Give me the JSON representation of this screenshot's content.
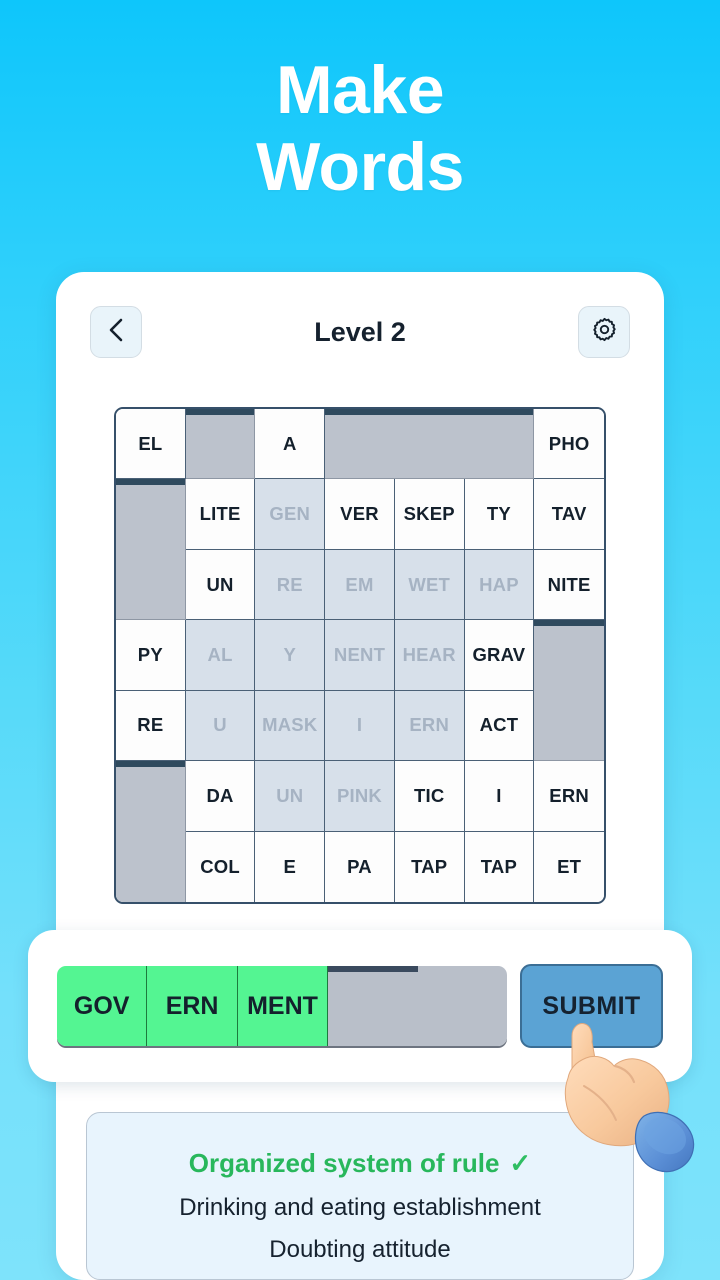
{
  "headline": {
    "line1": "Make",
    "line2": "Words"
  },
  "appbar": {
    "title": "Level 2",
    "back_icon": "chevron-left-icon",
    "settings_icon": "gear-icon"
  },
  "grid": {
    "rows": 7,
    "cols": 7,
    "cells": [
      [
        {
          "text": "EL",
          "state": "available"
        },
        {
          "text": "",
          "state": "blocked"
        },
        {
          "text": "A",
          "state": "available"
        },
        {
          "text": "",
          "state": "blocked"
        },
        {
          "text": "",
          "state": "blocked"
        },
        {
          "text": "",
          "state": "blocked"
        },
        {
          "text": "PHO",
          "state": "available"
        }
      ],
      [
        {
          "text": "",
          "state": "blocked"
        },
        {
          "text": "LITE",
          "state": "available"
        },
        {
          "text": "GEN",
          "state": "used"
        },
        {
          "text": "VER",
          "state": "available"
        },
        {
          "text": "SKEP",
          "state": "available"
        },
        {
          "text": "TY",
          "state": "available"
        },
        {
          "text": "TAV",
          "state": "available"
        }
      ],
      [
        {
          "text": "",
          "state": "blocked"
        },
        {
          "text": "UN",
          "state": "available"
        },
        {
          "text": "RE",
          "state": "used"
        },
        {
          "text": "EM",
          "state": "used"
        },
        {
          "text": "WET",
          "state": "used"
        },
        {
          "text": "HAP",
          "state": "used"
        },
        {
          "text": "NITE",
          "state": "available"
        }
      ],
      [
        {
          "text": "PY",
          "state": "available"
        },
        {
          "text": "AL",
          "state": "used"
        },
        {
          "text": "Y",
          "state": "used"
        },
        {
          "text": "NENT",
          "state": "used"
        },
        {
          "text": "HEAR",
          "state": "used"
        },
        {
          "text": "GRAV",
          "state": "available"
        },
        {
          "text": "",
          "state": "blocked"
        }
      ],
      [
        {
          "text": "RE",
          "state": "available"
        },
        {
          "text": "U",
          "state": "used"
        },
        {
          "text": "MASK",
          "state": "used"
        },
        {
          "text": "I",
          "state": "used"
        },
        {
          "text": "ERN",
          "state": "used"
        },
        {
          "text": "ACT",
          "state": "available"
        },
        {
          "text": "",
          "state": "blocked"
        }
      ],
      [
        {
          "text": "",
          "state": "blocked"
        },
        {
          "text": "DA",
          "state": "available"
        },
        {
          "text": "UN",
          "state": "used"
        },
        {
          "text": "PINK",
          "state": "used"
        },
        {
          "text": "TIC",
          "state": "available"
        },
        {
          "text": "I",
          "state": "available"
        },
        {
          "text": "ERN",
          "state": "available"
        }
      ],
      [
        {
          "text": "",
          "state": "blocked"
        },
        {
          "text": "COL",
          "state": "available"
        },
        {
          "text": "E",
          "state": "available"
        },
        {
          "text": "PA",
          "state": "available"
        },
        {
          "text": "TAP",
          "state": "available"
        },
        {
          "text": "TAP",
          "state": "available"
        },
        {
          "text": "ET",
          "state": "available"
        }
      ]
    ]
  },
  "answer": {
    "slots": [
      {
        "text": "GOV",
        "filled": true
      },
      {
        "text": "ERN",
        "filled": true
      },
      {
        "text": "MENT",
        "filled": true
      },
      {
        "text": "",
        "filled": false
      },
      {
        "text": "",
        "filled": false
      }
    ],
    "submit_label": "SUBMIT"
  },
  "clues": [
    {
      "text": "Organized system of rule",
      "solved": true,
      "tick": "✓"
    },
    {
      "text": "Drinking and eating establishment",
      "solved": false,
      "tick": ""
    },
    {
      "text": "Doubting attitude",
      "solved": false,
      "tick": ""
    }
  ],
  "colors": {
    "background_top": "#0ec6fb",
    "background_bottom": "#7ee3fb",
    "tile_available": "#fdfdfd",
    "tile_used": "#d7e0ea",
    "tile_blocked": "#bcc2cc",
    "slot_filled": "#54f592",
    "slot_empty": "#b9bfc9",
    "submit": "#5ba3d4",
    "clue_solved": "#28b75c",
    "clue_panel": "#e8f4fd"
  },
  "cursor": {
    "icon": "pointing-hand-cursor"
  }
}
